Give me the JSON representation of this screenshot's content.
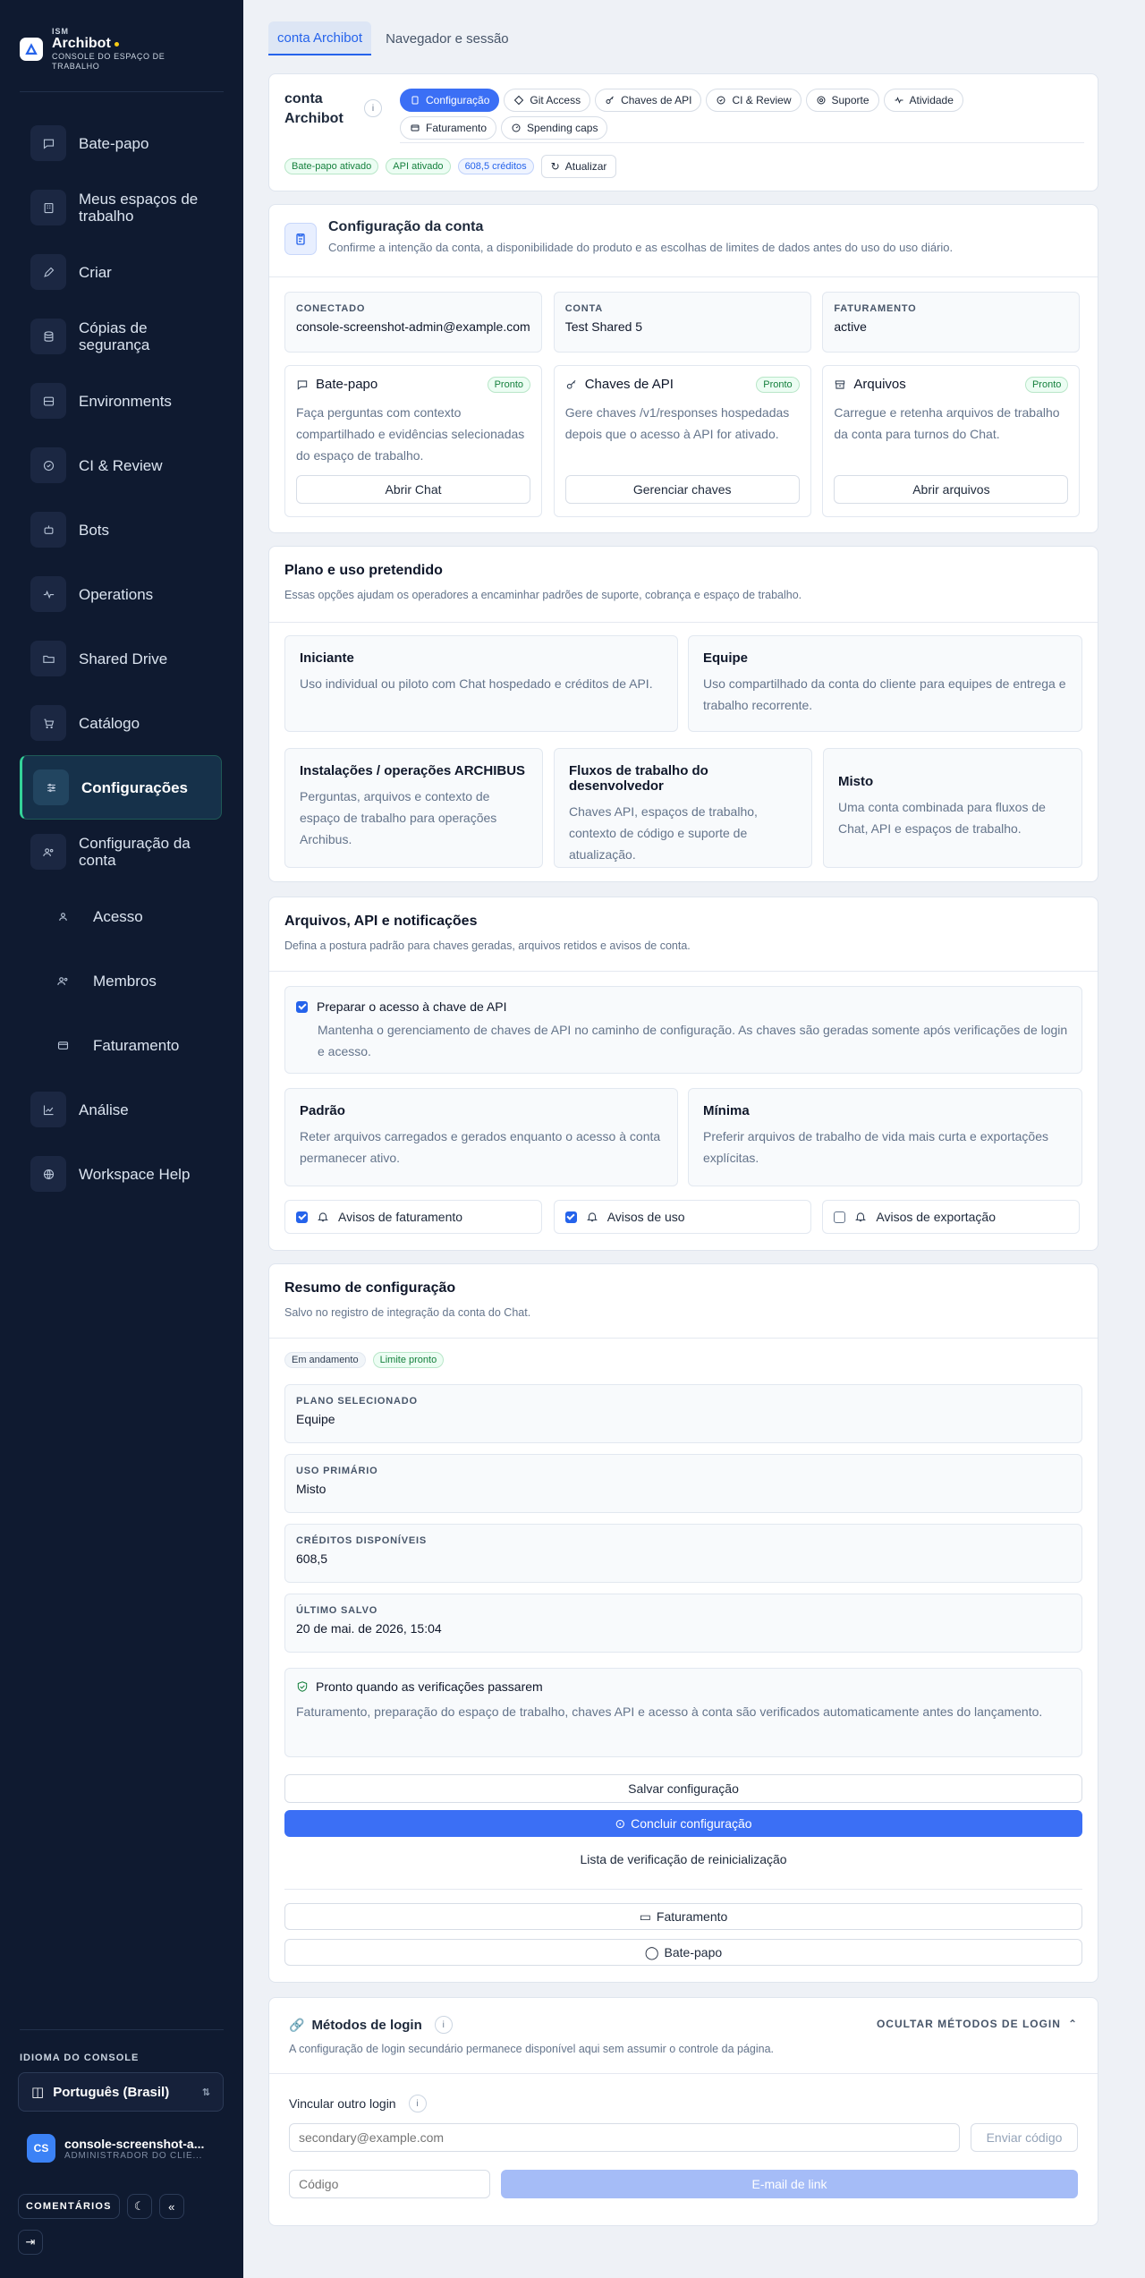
{
  "brand": {
    "org": "ISM",
    "name": "Archibot",
    "subtitle": "CONSOLE DO ESPAÇO DE TRABALHO"
  },
  "sidebar": {
    "items": [
      {
        "label": "Bate-papo",
        "icon": "chat-icon"
      },
      {
        "label": "Meus espaços de trabalho",
        "icon": "grid-icon"
      },
      {
        "label": "Criar",
        "icon": "pen-icon"
      },
      {
        "label": "Cópias de segurança",
        "icon": "database-icon"
      },
      {
        "label": "Environments",
        "icon": "server-icon"
      },
      {
        "label": "CI & Review",
        "icon": "check-circle-icon"
      },
      {
        "label": "Bots",
        "icon": "bot-icon"
      },
      {
        "label": "Operations",
        "icon": "pulse-icon"
      },
      {
        "label": "Shared Drive",
        "icon": "folder-icon"
      },
      {
        "label": "Catálogo",
        "icon": "cart-icon"
      },
      {
        "label": "Configurações",
        "icon": "sliders-icon",
        "active": true
      },
      {
        "label": "Configuração da conta",
        "icon": "users-icon"
      },
      {
        "label": "Acesso",
        "icon": "user-icon",
        "sub": true
      },
      {
        "label": "Membros",
        "icon": "users-icon",
        "sub": true
      },
      {
        "label": "Faturamento",
        "icon": "card-icon",
        "sub": true
      },
      {
        "label": "Análise",
        "icon": "chart-icon"
      },
      {
        "label": "Workspace Help",
        "icon": "globe-icon"
      }
    ],
    "language_label": "IDIOMA DO CONSOLE",
    "language_value": "Português (Brasil)",
    "user": {
      "initials": "CS",
      "name": "console-screenshot-a...",
      "role": "ADMINISTRADOR DO CLIE..."
    },
    "feedback_label": "COMENTÁRIOS"
  },
  "top_tabs": [
    "conta Archibot",
    "Navegador e sessão"
  ],
  "account": {
    "title": "conta Archibot",
    "tabs": [
      "Configuração",
      "Git Access",
      "Chaves de API",
      "CI & Review",
      "Suporte",
      "Atividade",
      "Faturamento",
      "Spending caps"
    ],
    "badges": [
      "Bate-papo ativado",
      "API ativado",
      "608,5 créditos"
    ],
    "refresh_label": "Atualizar"
  },
  "config": {
    "title": "Configuração da conta",
    "subtitle": "Confirme a intenção da conta, a disponibilidade do produto e as escolhas de limites de dados antes do uso do uso diário.",
    "kv": [
      {
        "key": "CONECTADO",
        "value": "console-screenshot-admin@example.com"
      },
      {
        "key": "CONTA",
        "value": "Test Shared 5"
      },
      {
        "key": "FATURAMENTO",
        "value": "active"
      }
    ],
    "products": [
      {
        "title": "Bate-papo",
        "status": "Pronto",
        "desc": "Faça perguntas com contexto compartilhado e evidências selecionadas do espaço de trabalho.",
        "button": "Abrir Chat"
      },
      {
        "title": "Chaves de API",
        "status": "Pronto",
        "desc": "Gere chaves /v1/responses hospedadas depois que o acesso à API for ativado.",
        "button": "Gerenciar chaves"
      },
      {
        "title": "Arquivos",
        "status": "Pronto",
        "desc": "Carregue e retenha arquivos de trabalho da conta para turnos do Chat.",
        "button": "Abrir arquivos"
      }
    ]
  },
  "plan": {
    "title": "Plano e uso pretendido",
    "subtitle": "Essas opções ajudam os operadores a encaminhar padrões de suporte, cobrança e espaço de trabalho.",
    "options": [
      {
        "title": "Iniciante",
        "desc": "Uso individual ou piloto com Chat hospedado e créditos de API."
      },
      {
        "title": "Equipe",
        "desc": "Uso compartilhado da conta do cliente para equipes de entrega e trabalho recorrente."
      },
      {
        "title": "Instalações / operações ARCHIBUS",
        "desc": "Perguntas, arquivos e contexto de espaço de trabalho para operações Archibus."
      },
      {
        "title": "Fluxos de trabalho do desenvolvedor",
        "desc": "Chaves API, espaços de trabalho, contexto de código e suporte de atualização."
      },
      {
        "title": "Misto",
        "desc": "Uma conta combinada para fluxos de Chat, API e espaços de trabalho."
      }
    ]
  },
  "files": {
    "title": "Arquivos, API e notificações",
    "subtitle": "Defina a postura padrão para chaves geradas, arquivos retidos e avisos de conta.",
    "api_check": {
      "label": "Preparar o acesso à chave de API",
      "desc": "Mantenha o gerenciamento de chaves de API no caminho de configuração. As chaves são geradas somente após verificações de login e acesso.",
      "checked": true
    },
    "retention": [
      {
        "title": "Padrão",
        "desc": "Reter arquivos carregados e gerados enquanto o acesso à conta permanecer ativo."
      },
      {
        "title": "Mínima",
        "desc": "Preferir arquivos de trabalho de vida mais curta e exportações explícitas."
      }
    ],
    "notices": [
      {
        "label": "Avisos de faturamento",
        "checked": true
      },
      {
        "label": "Avisos de uso",
        "checked": true
      },
      {
        "label": "Avisos de exportação",
        "checked": false
      }
    ]
  },
  "summary": {
    "title": "Resumo de configuração",
    "subtitle": "Salvo no registro de integração da conta do Chat.",
    "badges": [
      "Em andamento",
      "Limite pronto"
    ],
    "kv": [
      {
        "key": "PLANO SELECIONADO",
        "value": "Equipe"
      },
      {
        "key": "USO PRIMÁRIO",
        "value": "Misto"
      },
      {
        "key": "CRÉDITOS DISPONÍVEIS",
        "value": "608,5"
      },
      {
        "key": "ÚLTIMO SALVO",
        "value": "20 de mai. de 2026, 15:04"
      }
    ],
    "ready": {
      "title": "Pronto quando as verificações passarem",
      "desc": "Faturamento, preparação do espaço de trabalho, chaves API e acesso à conta são verificados automaticamente antes do lançamento."
    },
    "save_label": "Salvar configuração",
    "finish_label": "Concluir configuração",
    "reset_label": "Lista de verificação de reinicialização",
    "billing_label": "Faturamento",
    "chat_label": "Bate-papo"
  },
  "login": {
    "title": "Métodos de login",
    "hide_label": "OCULTAR MÉTODOS DE LOGIN",
    "subtitle": "A configuração de login secundário permanece disponível aqui sem assumir o controle da página.",
    "link_title": "Vincular outro login",
    "email_placeholder": "secondary@example.com",
    "send_label": "Enviar código",
    "code_placeholder": "Código",
    "link_label": "E-mail de link"
  },
  "colors": {
    "accent": "#3b6ff5",
    "sidebar": "#0f1a30",
    "ready_green": "#15803d"
  }
}
